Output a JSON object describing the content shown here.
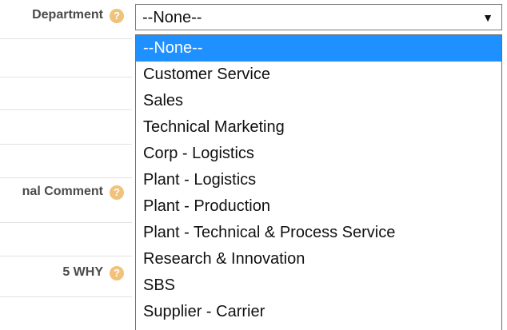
{
  "form": {
    "rows": [
      {
        "label": "Department"
      },
      {
        "label": "nal Comment"
      },
      {
        "label": "5 WHY"
      }
    ]
  },
  "icons": {
    "help": "help-icon",
    "help_glyph": "?",
    "dropdown_arrow": "▼"
  },
  "dropdown": {
    "selected_value": "--None--",
    "options": [
      "--None--",
      "Customer Service",
      "Sales",
      "Technical Marketing",
      "Corp - Logistics",
      "Plant - Logistics",
      "Plant - Production",
      "Plant - Technical & Process Service",
      "Research & Innovation",
      "SBS",
      "Supplier - Carrier"
    ],
    "highlighted_index": 0
  },
  "colors": {
    "highlight": "#1e90ff",
    "help_icon": "#f0c27a",
    "label_text": "#4a4a4a"
  }
}
